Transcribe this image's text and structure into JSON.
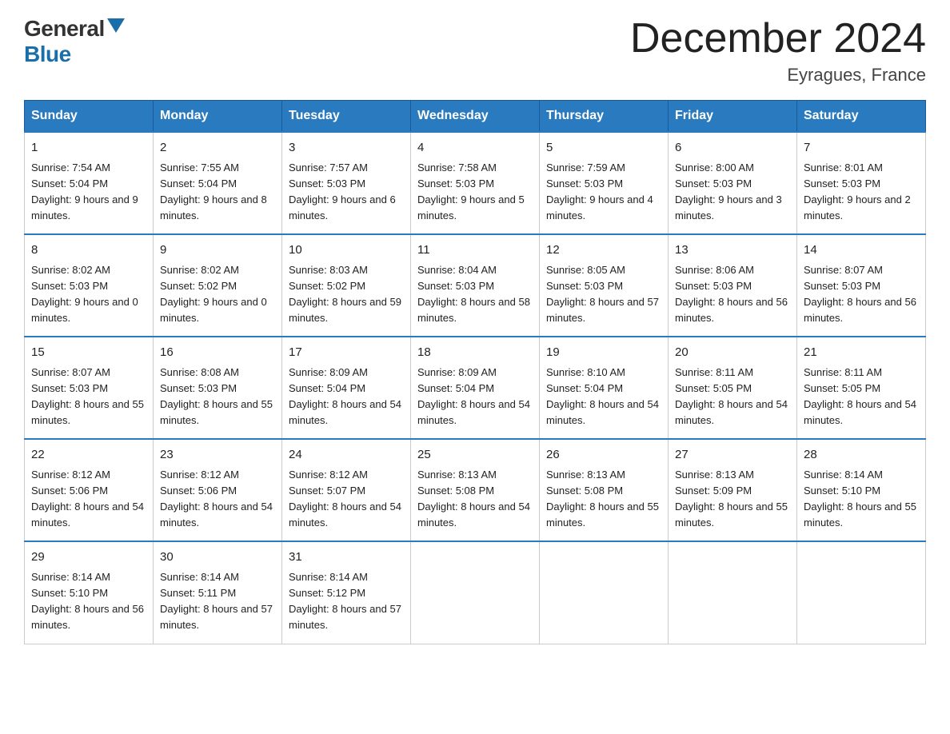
{
  "header": {
    "logo_general": "General",
    "logo_blue": "Blue",
    "month_title": "December 2024",
    "location": "Eyragues, France"
  },
  "weekdays": [
    "Sunday",
    "Monday",
    "Tuesday",
    "Wednesday",
    "Thursday",
    "Friday",
    "Saturday"
  ],
  "weeks": [
    [
      {
        "day": "1",
        "sunrise": "7:54 AM",
        "sunset": "5:04 PM",
        "daylight": "9 hours and 9 minutes."
      },
      {
        "day": "2",
        "sunrise": "7:55 AM",
        "sunset": "5:04 PM",
        "daylight": "9 hours and 8 minutes."
      },
      {
        "day": "3",
        "sunrise": "7:57 AM",
        "sunset": "5:03 PM",
        "daylight": "9 hours and 6 minutes."
      },
      {
        "day": "4",
        "sunrise": "7:58 AM",
        "sunset": "5:03 PM",
        "daylight": "9 hours and 5 minutes."
      },
      {
        "day": "5",
        "sunrise": "7:59 AM",
        "sunset": "5:03 PM",
        "daylight": "9 hours and 4 minutes."
      },
      {
        "day": "6",
        "sunrise": "8:00 AM",
        "sunset": "5:03 PM",
        "daylight": "9 hours and 3 minutes."
      },
      {
        "day": "7",
        "sunrise": "8:01 AM",
        "sunset": "5:03 PM",
        "daylight": "9 hours and 2 minutes."
      }
    ],
    [
      {
        "day": "8",
        "sunrise": "8:02 AM",
        "sunset": "5:03 PM",
        "daylight": "9 hours and 0 minutes."
      },
      {
        "day": "9",
        "sunrise": "8:02 AM",
        "sunset": "5:02 PM",
        "daylight": "9 hours and 0 minutes."
      },
      {
        "day": "10",
        "sunrise": "8:03 AM",
        "sunset": "5:02 PM",
        "daylight": "8 hours and 59 minutes."
      },
      {
        "day": "11",
        "sunrise": "8:04 AM",
        "sunset": "5:03 PM",
        "daylight": "8 hours and 58 minutes."
      },
      {
        "day": "12",
        "sunrise": "8:05 AM",
        "sunset": "5:03 PM",
        "daylight": "8 hours and 57 minutes."
      },
      {
        "day": "13",
        "sunrise": "8:06 AM",
        "sunset": "5:03 PM",
        "daylight": "8 hours and 56 minutes."
      },
      {
        "day": "14",
        "sunrise": "8:07 AM",
        "sunset": "5:03 PM",
        "daylight": "8 hours and 56 minutes."
      }
    ],
    [
      {
        "day": "15",
        "sunrise": "8:07 AM",
        "sunset": "5:03 PM",
        "daylight": "8 hours and 55 minutes."
      },
      {
        "day": "16",
        "sunrise": "8:08 AM",
        "sunset": "5:03 PM",
        "daylight": "8 hours and 55 minutes."
      },
      {
        "day": "17",
        "sunrise": "8:09 AM",
        "sunset": "5:04 PM",
        "daylight": "8 hours and 54 minutes."
      },
      {
        "day": "18",
        "sunrise": "8:09 AM",
        "sunset": "5:04 PM",
        "daylight": "8 hours and 54 minutes."
      },
      {
        "day": "19",
        "sunrise": "8:10 AM",
        "sunset": "5:04 PM",
        "daylight": "8 hours and 54 minutes."
      },
      {
        "day": "20",
        "sunrise": "8:11 AM",
        "sunset": "5:05 PM",
        "daylight": "8 hours and 54 minutes."
      },
      {
        "day": "21",
        "sunrise": "8:11 AM",
        "sunset": "5:05 PM",
        "daylight": "8 hours and 54 minutes."
      }
    ],
    [
      {
        "day": "22",
        "sunrise": "8:12 AM",
        "sunset": "5:06 PM",
        "daylight": "8 hours and 54 minutes."
      },
      {
        "day": "23",
        "sunrise": "8:12 AM",
        "sunset": "5:06 PM",
        "daylight": "8 hours and 54 minutes."
      },
      {
        "day": "24",
        "sunrise": "8:12 AM",
        "sunset": "5:07 PM",
        "daylight": "8 hours and 54 minutes."
      },
      {
        "day": "25",
        "sunrise": "8:13 AM",
        "sunset": "5:08 PM",
        "daylight": "8 hours and 54 minutes."
      },
      {
        "day": "26",
        "sunrise": "8:13 AM",
        "sunset": "5:08 PM",
        "daylight": "8 hours and 55 minutes."
      },
      {
        "day": "27",
        "sunrise": "8:13 AM",
        "sunset": "5:09 PM",
        "daylight": "8 hours and 55 minutes."
      },
      {
        "day": "28",
        "sunrise": "8:14 AM",
        "sunset": "5:10 PM",
        "daylight": "8 hours and 55 minutes."
      }
    ],
    [
      {
        "day": "29",
        "sunrise": "8:14 AM",
        "sunset": "5:10 PM",
        "daylight": "8 hours and 56 minutes."
      },
      {
        "day": "30",
        "sunrise": "8:14 AM",
        "sunset": "5:11 PM",
        "daylight": "8 hours and 57 minutes."
      },
      {
        "day": "31",
        "sunrise": "8:14 AM",
        "sunset": "5:12 PM",
        "daylight": "8 hours and 57 minutes."
      },
      null,
      null,
      null,
      null
    ]
  ],
  "labels": {
    "sunrise": "Sunrise:",
    "sunset": "Sunset:",
    "daylight": "Daylight:"
  }
}
